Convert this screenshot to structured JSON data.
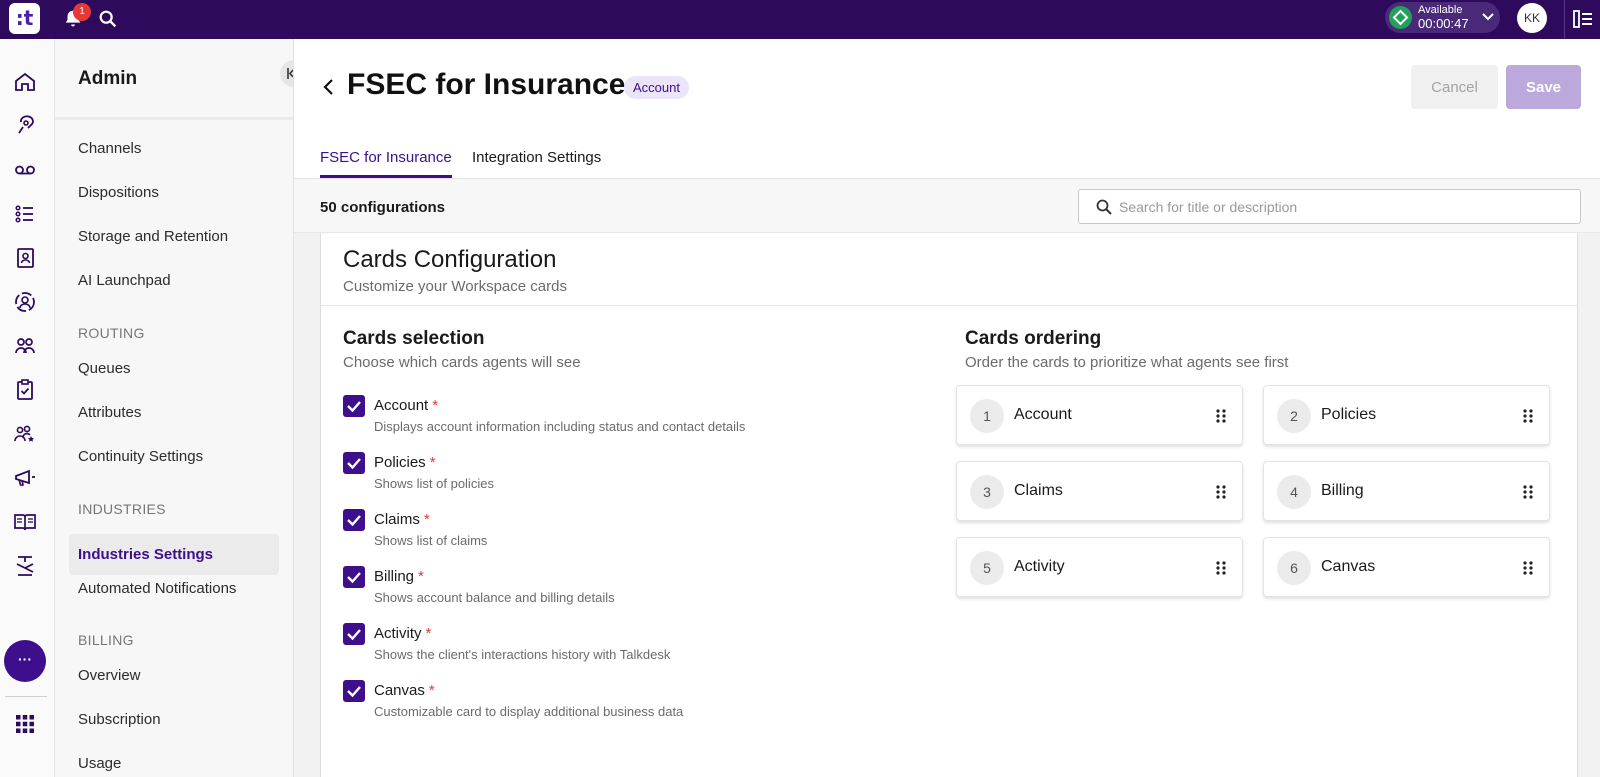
{
  "topbar": {
    "logo_text": ":t",
    "notification_count": "1",
    "status_label": "Available",
    "status_time": "00:00:47",
    "avatar_initials": "KK",
    "status_color": "#23a05a",
    "brand_color": "#2e0a5c"
  },
  "rail": {
    "icons": [
      "home-icon",
      "voice-icon",
      "voicemail-icon",
      "list-icon",
      "contacts-icon",
      "user-circle-icon",
      "team-icon",
      "clipboard-icon",
      "people-star-icon",
      "megaphone-icon",
      "book-icon",
      "flow-icon"
    ],
    "more_label": "···",
    "apps_icon": "apps-grid-icon"
  },
  "sidebar": {
    "title": "Admin",
    "items_top": [
      "Channels",
      "Dispositions",
      "Storage and Retention",
      "AI Launchpad"
    ],
    "routing_header": "ROUTING",
    "routing_items": [
      "Queues",
      "Attributes",
      "Continuity Settings"
    ],
    "industries_header": "INDUSTRIES",
    "industries_active": "Industries Settings",
    "industries_items": [
      "Automated Notifications"
    ],
    "billing_header": "BILLING",
    "billing_items": [
      "Overview",
      "Subscription",
      "Usage"
    ]
  },
  "main": {
    "title": "FSEC for Insurance",
    "badge": "Account",
    "cancel_label": "Cancel",
    "save_label": "Save",
    "tabs": [
      "FSEC for Insurance",
      "Integration Settings"
    ],
    "config_count": "50 configurations",
    "search_placeholder": "Search for title or description",
    "search_value": ""
  },
  "cards_config": {
    "title": "Cards Configuration",
    "subtitle": "Customize your Workspace cards",
    "selection_title": "Cards selection",
    "selection_subtitle": "Choose which cards agents will see",
    "ordering_title": "Cards ordering",
    "ordering_subtitle": "Order the cards to prioritize what agents see first",
    "required_marker": "*",
    "cards": [
      {
        "label": "Account",
        "desc": "Displays account information including status and contact details",
        "checked": true
      },
      {
        "label": "Policies",
        "desc": "Shows list of policies",
        "checked": true
      },
      {
        "label": "Claims",
        "desc": "Shows list of claims",
        "checked": true
      },
      {
        "label": "Billing",
        "desc": "Shows account balance and billing details",
        "checked": true
      },
      {
        "label": "Activity",
        "desc": "Shows the client's interactions history with Talkdesk",
        "checked": true
      },
      {
        "label": "Canvas",
        "desc": "Customizable card to display additional business data",
        "checked": true
      }
    ],
    "ordering": [
      {
        "num": "1",
        "label": "Account"
      },
      {
        "num": "2",
        "label": "Policies"
      },
      {
        "num": "3",
        "label": "Claims"
      },
      {
        "num": "4",
        "label": "Billing"
      },
      {
        "num": "5",
        "label": "Activity"
      },
      {
        "num": "6",
        "label": "Canvas"
      }
    ],
    "accent_color": "#3d0f8c"
  }
}
